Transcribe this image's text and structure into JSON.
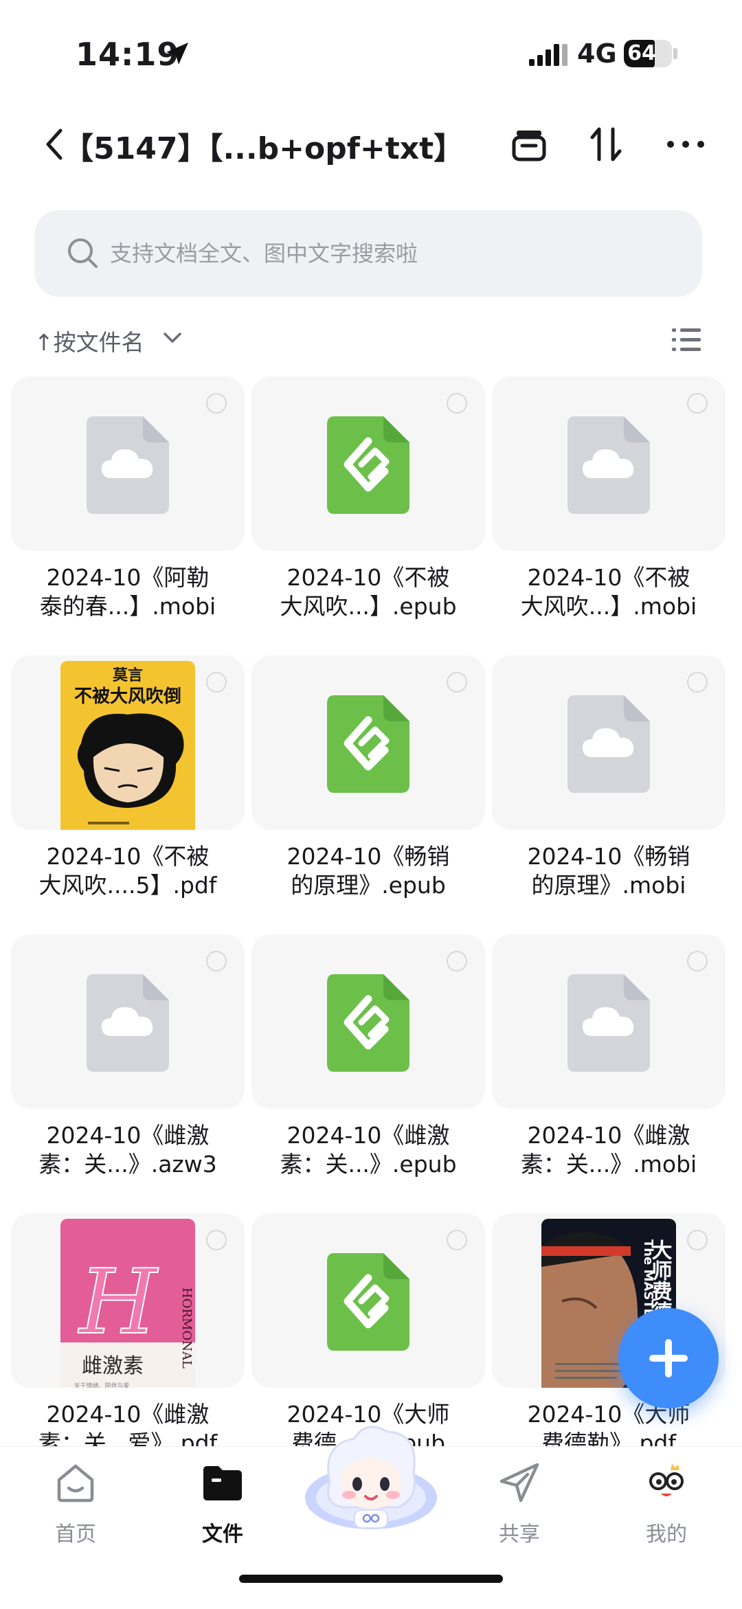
{
  "status": {
    "time": "14:19",
    "network": "4G",
    "battery": "64",
    "battery_level": 0.64
  },
  "header": {
    "title": "【5147】【...b+opf+txt】"
  },
  "search": {
    "placeholder": "支持文档全文、图中文字搜索啦"
  },
  "sort": {
    "label": "↑按文件名"
  },
  "files": [
    {
      "line1": "2024-10《阿勒",
      "line2": "泰的春...】.mobi",
      "icon": "cloud-file-icon"
    },
    {
      "line1": "2024-10《不被",
      "line2": "大风吹...】.epub",
      "icon": "epub-icon"
    },
    {
      "line1": "2024-10《不被",
      "line2": "大风吹...】.mobi",
      "icon": "cloud-file-icon"
    },
    {
      "line1": "2024-10《不被",
      "line2": "大风吹....5】.pdf",
      "icon": "book-cover",
      "cover": {
        "author": "莫言",
        "title": "不被大风吹倒"
      }
    },
    {
      "line1": "2024-10《畅销",
      "line2": "的原理》.epub",
      "icon": "epub-icon"
    },
    {
      "line1": "2024-10《畅销",
      "line2": "的原理》.mobi",
      "icon": "cloud-file-icon"
    },
    {
      "line1": "2024-10《雌激",
      "line2": "素：关...》.azw3",
      "icon": "cloud-file-icon"
    },
    {
      "line1": "2024-10《雌激",
      "line2": "素：关...》.epub",
      "icon": "epub-icon"
    },
    {
      "line1": "2024-10《雌激",
      "line2": "素：关...》.mobi",
      "icon": "cloud-file-icon"
    },
    {
      "line1": "2024-10《雌激",
      "line2": "素：关...爱》.pdf",
      "icon": "book-cover",
      "cover": {
        "title": "雌激素",
        "letter": "H",
        "side": "HORMONAL",
        "sub": "关于情绪、陪伴与爱"
      }
    },
    {
      "line1": "2024-10《大师",
      "line2": "费德...》.epub",
      "icon": "epub-icon"
    },
    {
      "line1": "2024-10《大师",
      "line2": "费德勒》.pdf",
      "icon": "book-cover",
      "cover": {
        "title": "大师费德",
        "side": "The MASTE"
      }
    }
  ],
  "nav": {
    "home": "首页",
    "files": "文件",
    "share": "共享",
    "mine": "我的"
  },
  "colors": {
    "accent": "#3f8cfb",
    "epub_green": "#6cc04a",
    "search_bg": "#f0f1f5"
  }
}
